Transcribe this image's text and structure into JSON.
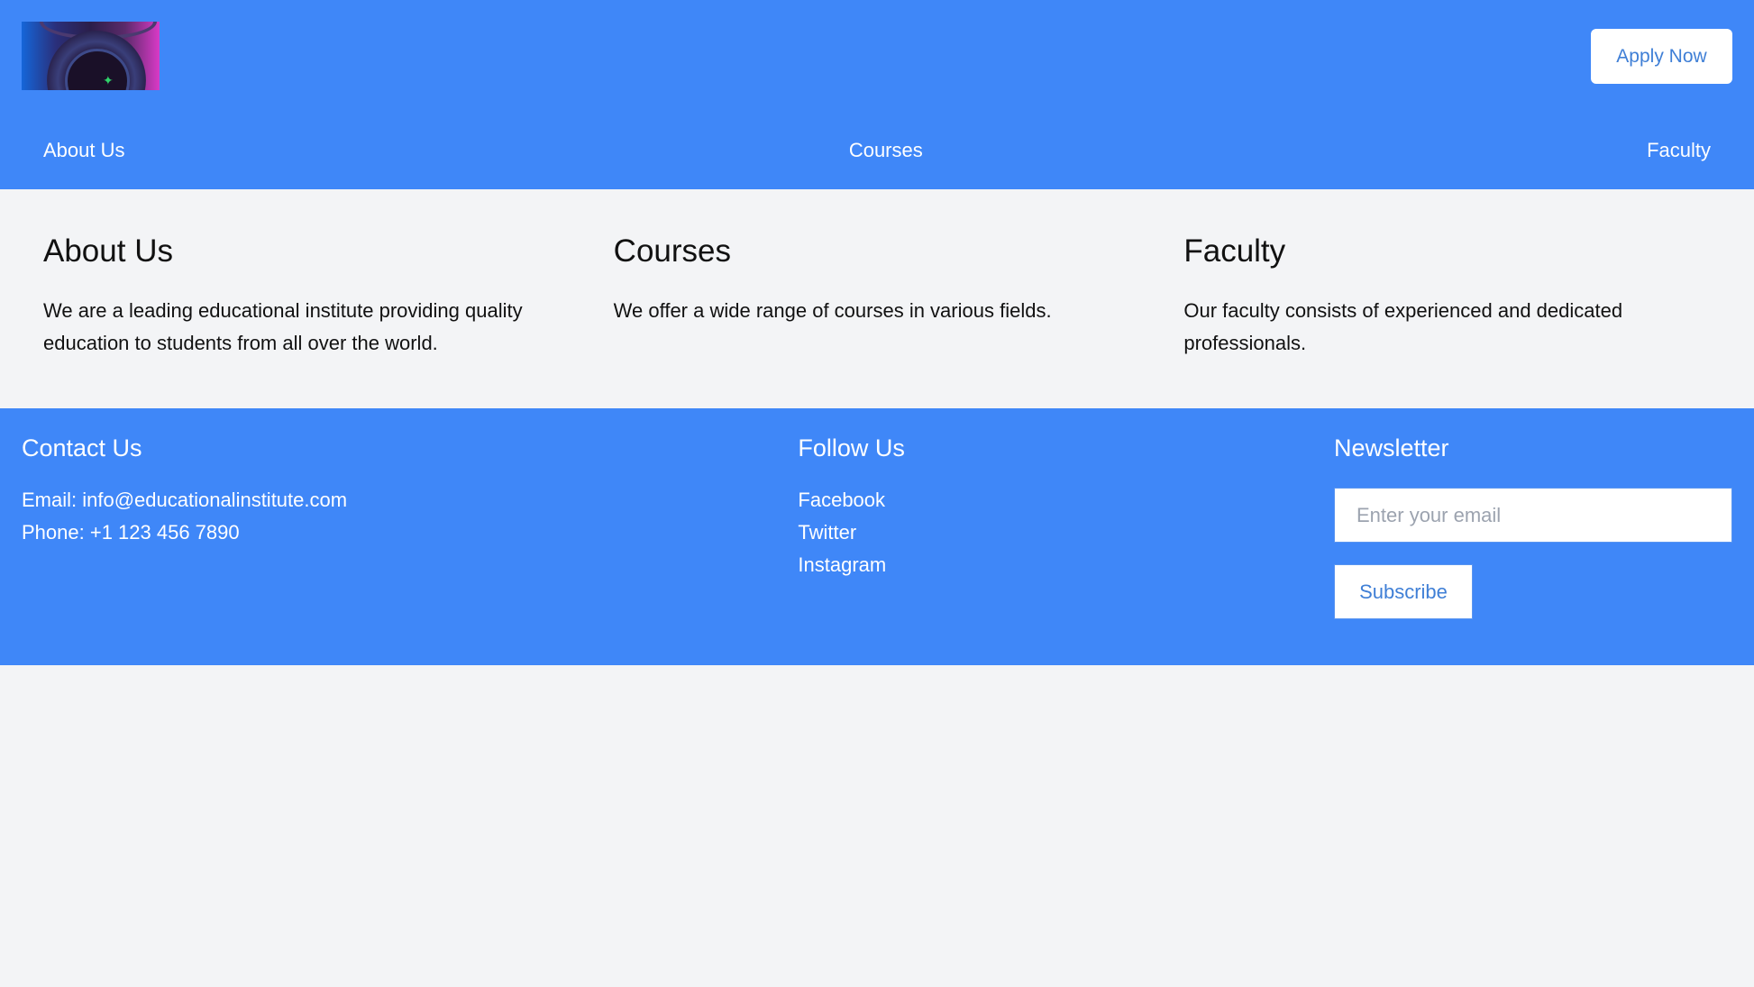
{
  "header": {
    "logo_alt": "Gaming headphones image",
    "apply_label": "Apply Now"
  },
  "nav": {
    "items": [
      {
        "label": "About Us"
      },
      {
        "label": "Courses"
      },
      {
        "label": "Faculty"
      }
    ]
  },
  "sections": [
    {
      "title": "About Us",
      "body": "We are a leading educational institute providing quality education to students from all over the world."
    },
    {
      "title": "Courses",
      "body": "We offer a wide range of courses in various fields."
    },
    {
      "title": "Faculty",
      "body": "Our faculty consists of experienced and dedicated professionals."
    }
  ],
  "footer": {
    "contact": {
      "title": "Contact Us",
      "email": "Email: info@educationalinstitute.com",
      "phone": "Phone: +1 123 456 7890"
    },
    "follow": {
      "title": "Follow Us",
      "links": [
        {
          "label": "Facebook"
        },
        {
          "label": "Twitter"
        },
        {
          "label": "Instagram"
        }
      ]
    },
    "newsletter": {
      "title": "Newsletter",
      "email_value": "",
      "email_placeholder": "Enter your email",
      "subscribe_label": "Subscribe"
    }
  },
  "colors": {
    "brand_blue": "#3f87f8",
    "button_text": "#3f7fd6",
    "page_bg": "#f3f4f6"
  }
}
